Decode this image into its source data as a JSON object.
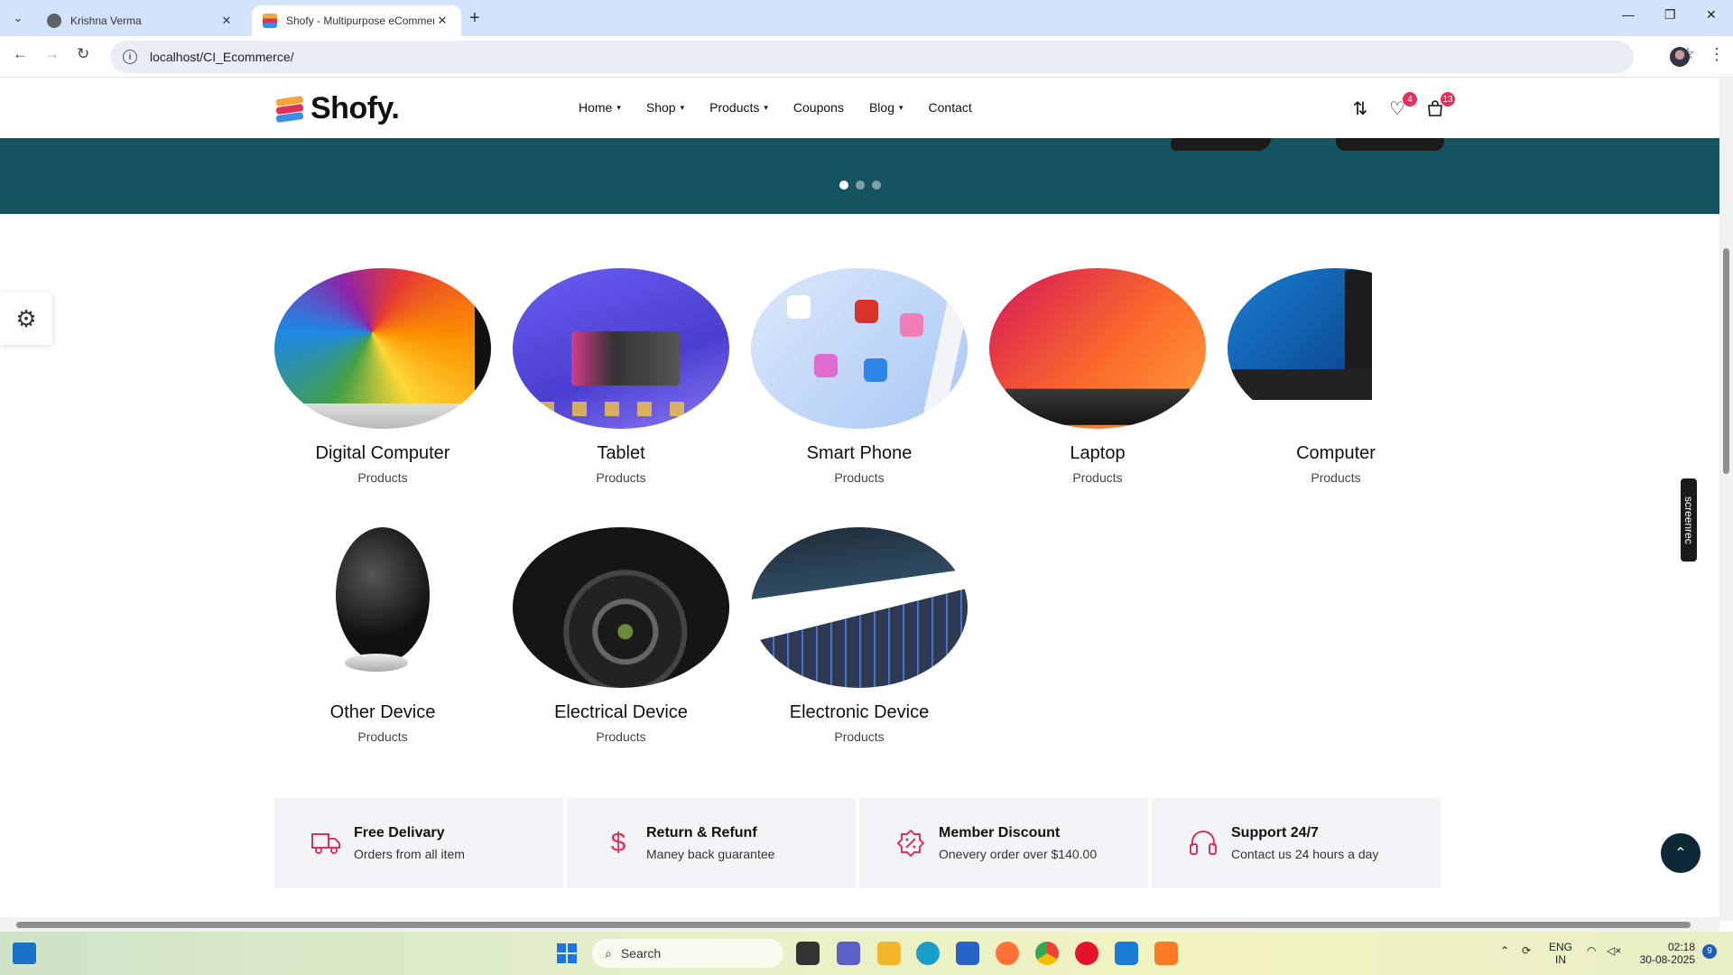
{
  "browser": {
    "tabs": [
      {
        "title": "Krishna Verma"
      },
      {
        "title": "Shofy - Multipurpose eCommerce"
      }
    ],
    "url": "localhost/CI_Ecommerce/"
  },
  "site": {
    "logo_text": "Shofy.",
    "nav": [
      {
        "label": "Home",
        "has_dropdown": true
      },
      {
        "label": "Shop",
        "has_dropdown": true
      },
      {
        "label": "Products",
        "has_dropdown": true
      },
      {
        "label": "Coupons",
        "has_dropdown": false
      },
      {
        "label": "Blog",
        "has_dropdown": true
      },
      {
        "label": "Contact",
        "has_dropdown": false
      }
    ],
    "wishlist_count": "4",
    "cart_count": "13",
    "accent_color": "#e0315a",
    "hero_color": "#145360"
  },
  "slider": {
    "slides": 3,
    "active_index": 0
  },
  "categories": [
    {
      "name": "Digital Computer",
      "sub": "Products",
      "image": "imac-swirl"
    },
    {
      "name": "Tablet",
      "sub": "Products",
      "image": "tablet-screen"
    },
    {
      "name": "Smart Phone",
      "sub": "Products",
      "image": "phone-apps"
    },
    {
      "name": "Laptop",
      "sub": "Products",
      "image": "laptop-pink"
    },
    {
      "name": "Computer",
      "sub": "Products",
      "image": "monitor-windows"
    },
    {
      "name": "Other Device",
      "sub": "Products",
      "image": "speaker"
    },
    {
      "name": "Electrical Device",
      "sub": "Products",
      "image": "camera-lens"
    },
    {
      "name": "Electronic Device",
      "sub": "Products",
      "image": "keyboard"
    }
  ],
  "features": [
    {
      "icon": "truck-icon",
      "title": "Free Delivary",
      "subtitle": "Orders from all item"
    },
    {
      "icon": "dollar-icon",
      "title": "Return & Refunf",
      "subtitle": "Maney back guarantee"
    },
    {
      "icon": "discount-icon",
      "title": "Member Discount",
      "subtitle": "Onevery order over $140.00"
    },
    {
      "icon": "headset-icon",
      "title": "Support 24/7",
      "subtitle": "Contact us 24 hours a day"
    }
  ],
  "overlay": {
    "screenrec_label": "screenrec"
  },
  "taskbar": {
    "search_placeholder": "Search",
    "language_top": "ENG",
    "language_bottom": "IN",
    "time": "02:18",
    "date": "30-08-2025",
    "notification_count": "9"
  }
}
